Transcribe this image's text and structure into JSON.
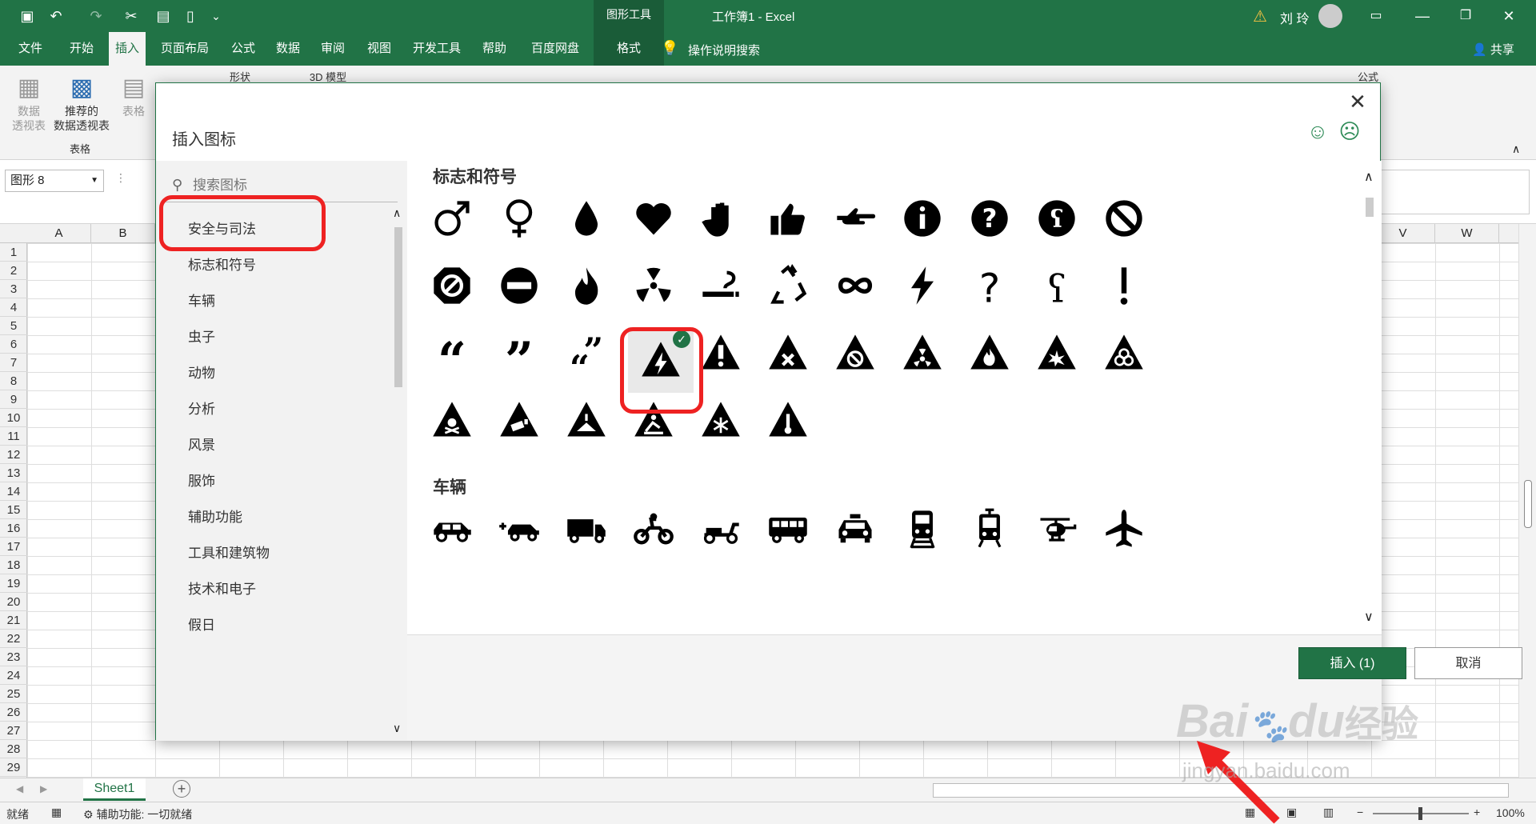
{
  "titlebar": {
    "context_tab": "图形工具",
    "doc_title": "工作簿1  -  Excel",
    "user": "刘 玲"
  },
  "tabs": [
    "文件",
    "开始",
    "插入",
    "页面布局",
    "公式",
    "数据",
    "审阅",
    "视图",
    "开发工具",
    "帮助",
    "百度网盘",
    "格式"
  ],
  "tell_me": "操作说明搜索",
  "share": "共享",
  "ribbon": {
    "pivot": "数据\n透视表",
    "recommended_pivot": "推荐的\n数据透视表",
    "table": "表格",
    "group_table": "表格",
    "shapes": "形状",
    "model3d": "3D 模型",
    "formula": "公式"
  },
  "formula_bar": {
    "name_box": "图形 8"
  },
  "columns": [
    "A",
    "B",
    "V",
    "W"
  ],
  "rows": [
    "1",
    "2",
    "3",
    "4",
    "5",
    "6",
    "7",
    "8",
    "9",
    "10",
    "11",
    "12",
    "13",
    "14",
    "15",
    "16",
    "17",
    "18",
    "19",
    "20",
    "21",
    "22",
    "23",
    "24",
    "25",
    "26",
    "27",
    "28",
    "29"
  ],
  "sheet_tab": "Sheet1",
  "status": {
    "ready": "就绪",
    "accessibility": "辅助功能: 一切就绪",
    "zoom": "100%"
  },
  "dialog": {
    "title": "插入图标",
    "search_placeholder": "搜索图标",
    "categories": [
      "安全与司法",
      "标志和符号",
      "车辆",
      "虫子",
      "动物",
      "分析",
      "风景",
      "服饰",
      "辅助功能",
      "工具和建筑物",
      "技术和电子",
      "假日"
    ],
    "section1": "标志和符号",
    "section2": "车辆",
    "insert_button": "插入 (1)",
    "cancel_button": "取消"
  },
  "colors": {
    "excel_green": "#217346",
    "highlight_red": "#e22"
  },
  "watermark": {
    "brand": "Bai",
    "brand2": "du",
    "jingyan": "经验",
    "url": "jingyan.baidu.com"
  }
}
